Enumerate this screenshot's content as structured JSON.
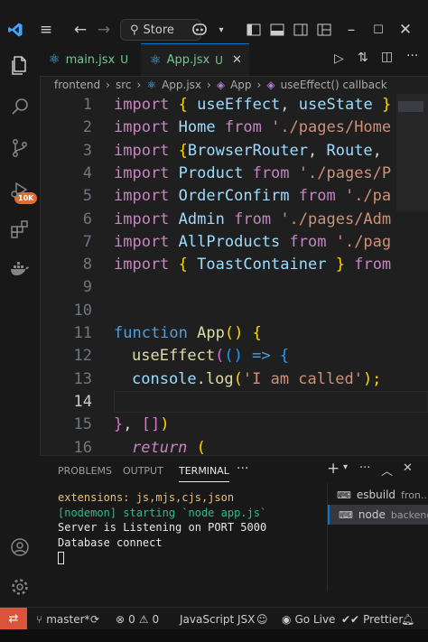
{
  "titlebar": {
    "search_label": "Store"
  },
  "tabs": [
    {
      "label": "main.jsx",
      "status": "U"
    },
    {
      "label": "App.jsx",
      "status": "U"
    }
  ],
  "breadcrumb": [
    "frontend",
    "src",
    "App.jsx",
    "App",
    "useEffect() callback"
  ],
  "activity_badge": "10K",
  "editor": {
    "lines": [
      {
        "n": "1"
      },
      {
        "n": "2"
      },
      {
        "n": "3"
      },
      {
        "n": "4"
      },
      {
        "n": "5"
      },
      {
        "n": "6"
      },
      {
        "n": "7"
      },
      {
        "n": "8"
      },
      {
        "n": "9"
      },
      {
        "n": "10"
      },
      {
        "n": "11"
      },
      {
        "n": "12"
      },
      {
        "n": "13"
      },
      {
        "n": "14"
      },
      {
        "n": "15"
      },
      {
        "n": "16"
      }
    ],
    "code": {
      "l1": [
        "import",
        "{",
        "useEffect",
        ",",
        "useState",
        "}"
      ],
      "l2": [
        "import",
        "Home",
        "from",
        "'./pages/Home"
      ],
      "l3": [
        "import",
        "{",
        "BrowserRouter",
        ",",
        "Route",
        ","
      ],
      "l4": [
        "import",
        "Product",
        "from",
        "'./pages/P"
      ],
      "l5": [
        "import",
        "OrderConfirm",
        "from",
        "'./pa"
      ],
      "l6": [
        "import",
        "Admin",
        "from",
        "'./pages/Adm"
      ],
      "l7": [
        "import",
        "AllProducts",
        "from",
        "'./pag"
      ],
      "l8": [
        "import",
        "{",
        "ToastContainer",
        "}",
        "from"
      ],
      "l11": [
        "function",
        "App",
        "()",
        "{"
      ],
      "l12": [
        "useEffect",
        "(",
        "()",
        "=>",
        "{"
      ],
      "l13": [
        "console",
        ".",
        "log",
        "(",
        "'I am called'",
        ");"
      ],
      "l15": [
        "}",
        ",",
        "[]",
        ")"
      ],
      "l16": [
        "return",
        "("
      ]
    }
  },
  "panel": {
    "tabs": [
      "PROBLEMS",
      "OUTPUT",
      "TERMINAL"
    ],
    "terminal_lines": [
      "extensions: js,mjs,cjs,json",
      "[nodemon] starting `node app.js`",
      "Server is Listening on PORT 5000",
      "Database connect"
    ],
    "terminals": [
      {
        "name": "esbuild",
        "desc": "fron..."
      },
      {
        "name": "node",
        "desc": "backend"
      }
    ]
  },
  "statusbar": {
    "branch": "master*",
    "errors": "0",
    "warnings": "0",
    "language": "JavaScript JSX",
    "golive": "Go Live",
    "prettier": "Prettier"
  },
  "colors": {
    "accent": "#0078d4",
    "remote": "#d9543a",
    "badge": "#e06c2f"
  }
}
